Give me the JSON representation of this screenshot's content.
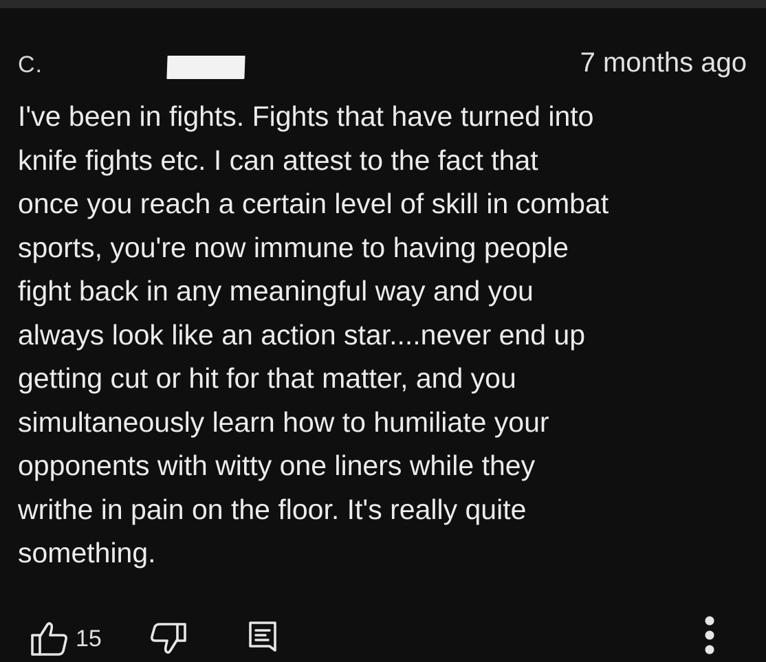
{
  "comment": {
    "author_initial": "C.",
    "timestamp": "7 months ago",
    "body_lines": [
      "I've been in fights. Fights that have turned into",
      "knife fights etc. I can attest to the fact that",
      "once you reach a certain level of skill in combat",
      "sports, you're now immune to having people",
      "fight back in any meaningful way and you",
      "always look like an action star....never end up",
      "getting cut or hit for that matter, and you",
      "simultaneously learn how to humiliate your",
      "opponents with witty one liners while they",
      "writhe in pain on the floor. It's really quite",
      "something."
    ]
  },
  "actions": {
    "like_icon": "thumbs-up-icon",
    "like_count": "15",
    "dislike_icon": "thumbs-down-icon",
    "reply_icon": "reply-comment-icon",
    "more_icon": "more-vertical-icon"
  },
  "colors": {
    "background": "#0f0f0f",
    "text": "#ececec",
    "redaction": "#f2f2f2"
  }
}
